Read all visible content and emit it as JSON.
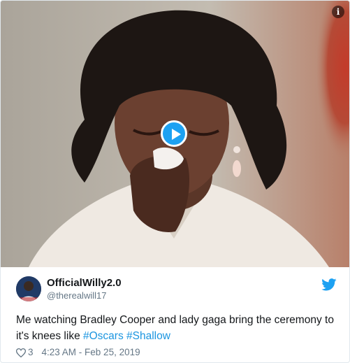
{
  "tweet": {
    "display_name": "OfficialWilly2.0",
    "handle": "@therealwill17",
    "text_prefix": "Me watching Bradley Cooper and lady gaga bring the ceremony to it's knees like ",
    "hashtags": [
      "#Oscars",
      "#Shallow"
    ],
    "like_count": "3",
    "timestamp": "4:23 AM - Feb 25, 2019"
  },
  "icons": {
    "play": "play-icon",
    "info": "info-icon",
    "platform": "twitter-bird-icon",
    "like": "heart-icon"
  },
  "colors": {
    "accent": "#1da1f2",
    "link": "#1b95e0",
    "muted": "#657786",
    "text": "#14171a"
  }
}
